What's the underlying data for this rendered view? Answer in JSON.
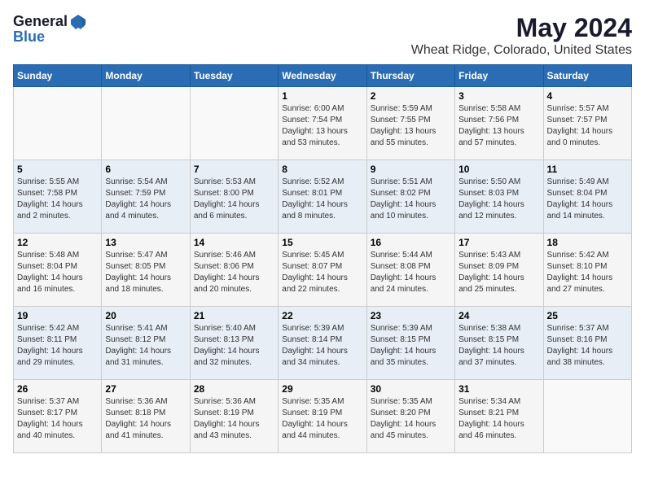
{
  "logo": {
    "text_general": "General",
    "text_blue": "Blue"
  },
  "title": "May 2024",
  "subtitle": "Wheat Ridge, Colorado, United States",
  "weekdays": [
    "Sunday",
    "Monday",
    "Tuesday",
    "Wednesday",
    "Thursday",
    "Friday",
    "Saturday"
  ],
  "weeks": [
    [
      {
        "day": "",
        "info": ""
      },
      {
        "day": "",
        "info": ""
      },
      {
        "day": "",
        "info": ""
      },
      {
        "day": "1",
        "info": "Sunrise: 6:00 AM\nSunset: 7:54 PM\nDaylight: 13 hours\nand 53 minutes."
      },
      {
        "day": "2",
        "info": "Sunrise: 5:59 AM\nSunset: 7:55 PM\nDaylight: 13 hours\nand 55 minutes."
      },
      {
        "day": "3",
        "info": "Sunrise: 5:58 AM\nSunset: 7:56 PM\nDaylight: 13 hours\nand 57 minutes."
      },
      {
        "day": "4",
        "info": "Sunrise: 5:57 AM\nSunset: 7:57 PM\nDaylight: 14 hours\nand 0 minutes."
      }
    ],
    [
      {
        "day": "5",
        "info": "Sunrise: 5:55 AM\nSunset: 7:58 PM\nDaylight: 14 hours\nand 2 minutes."
      },
      {
        "day": "6",
        "info": "Sunrise: 5:54 AM\nSunset: 7:59 PM\nDaylight: 14 hours\nand 4 minutes."
      },
      {
        "day": "7",
        "info": "Sunrise: 5:53 AM\nSunset: 8:00 PM\nDaylight: 14 hours\nand 6 minutes."
      },
      {
        "day": "8",
        "info": "Sunrise: 5:52 AM\nSunset: 8:01 PM\nDaylight: 14 hours\nand 8 minutes."
      },
      {
        "day": "9",
        "info": "Sunrise: 5:51 AM\nSunset: 8:02 PM\nDaylight: 14 hours\nand 10 minutes."
      },
      {
        "day": "10",
        "info": "Sunrise: 5:50 AM\nSunset: 8:03 PM\nDaylight: 14 hours\nand 12 minutes."
      },
      {
        "day": "11",
        "info": "Sunrise: 5:49 AM\nSunset: 8:04 PM\nDaylight: 14 hours\nand 14 minutes."
      }
    ],
    [
      {
        "day": "12",
        "info": "Sunrise: 5:48 AM\nSunset: 8:04 PM\nDaylight: 14 hours\nand 16 minutes."
      },
      {
        "day": "13",
        "info": "Sunrise: 5:47 AM\nSunset: 8:05 PM\nDaylight: 14 hours\nand 18 minutes."
      },
      {
        "day": "14",
        "info": "Sunrise: 5:46 AM\nSunset: 8:06 PM\nDaylight: 14 hours\nand 20 minutes."
      },
      {
        "day": "15",
        "info": "Sunrise: 5:45 AM\nSunset: 8:07 PM\nDaylight: 14 hours\nand 22 minutes."
      },
      {
        "day": "16",
        "info": "Sunrise: 5:44 AM\nSunset: 8:08 PM\nDaylight: 14 hours\nand 24 minutes."
      },
      {
        "day": "17",
        "info": "Sunrise: 5:43 AM\nSunset: 8:09 PM\nDaylight: 14 hours\nand 25 minutes."
      },
      {
        "day": "18",
        "info": "Sunrise: 5:42 AM\nSunset: 8:10 PM\nDaylight: 14 hours\nand 27 minutes."
      }
    ],
    [
      {
        "day": "19",
        "info": "Sunrise: 5:42 AM\nSunset: 8:11 PM\nDaylight: 14 hours\nand 29 minutes."
      },
      {
        "day": "20",
        "info": "Sunrise: 5:41 AM\nSunset: 8:12 PM\nDaylight: 14 hours\nand 31 minutes."
      },
      {
        "day": "21",
        "info": "Sunrise: 5:40 AM\nSunset: 8:13 PM\nDaylight: 14 hours\nand 32 minutes."
      },
      {
        "day": "22",
        "info": "Sunrise: 5:39 AM\nSunset: 8:14 PM\nDaylight: 14 hours\nand 34 minutes."
      },
      {
        "day": "23",
        "info": "Sunrise: 5:39 AM\nSunset: 8:15 PM\nDaylight: 14 hours\nand 35 minutes."
      },
      {
        "day": "24",
        "info": "Sunrise: 5:38 AM\nSunset: 8:15 PM\nDaylight: 14 hours\nand 37 minutes."
      },
      {
        "day": "25",
        "info": "Sunrise: 5:37 AM\nSunset: 8:16 PM\nDaylight: 14 hours\nand 38 minutes."
      }
    ],
    [
      {
        "day": "26",
        "info": "Sunrise: 5:37 AM\nSunset: 8:17 PM\nDaylight: 14 hours\nand 40 minutes."
      },
      {
        "day": "27",
        "info": "Sunrise: 5:36 AM\nSunset: 8:18 PM\nDaylight: 14 hours\nand 41 minutes."
      },
      {
        "day": "28",
        "info": "Sunrise: 5:36 AM\nSunset: 8:19 PM\nDaylight: 14 hours\nand 43 minutes."
      },
      {
        "day": "29",
        "info": "Sunrise: 5:35 AM\nSunset: 8:19 PM\nDaylight: 14 hours\nand 44 minutes."
      },
      {
        "day": "30",
        "info": "Sunrise: 5:35 AM\nSunset: 8:20 PM\nDaylight: 14 hours\nand 45 minutes."
      },
      {
        "day": "31",
        "info": "Sunrise: 5:34 AM\nSunset: 8:21 PM\nDaylight: 14 hours\nand 46 minutes."
      },
      {
        "day": "",
        "info": ""
      }
    ]
  ]
}
